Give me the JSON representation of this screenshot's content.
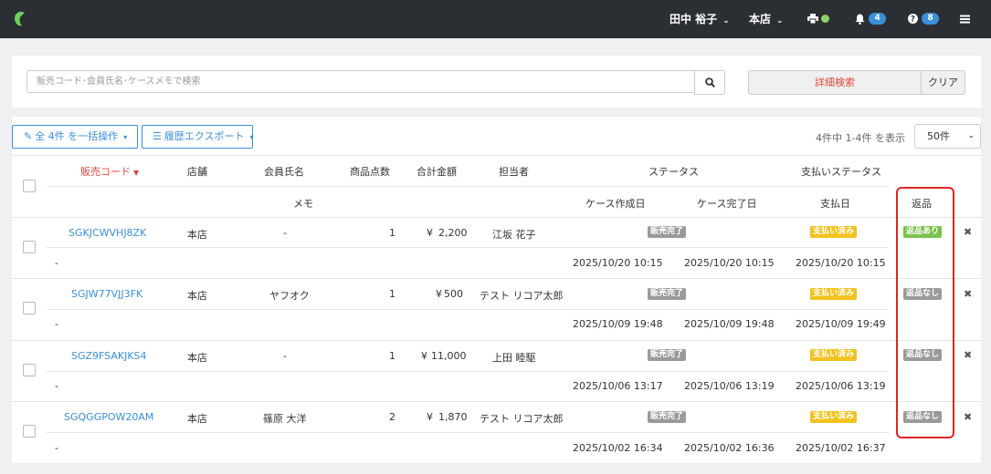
{
  "header": {
    "user_name": "田中 裕子",
    "store": "本店",
    "notifications_count": "4",
    "help_count": "8",
    "colors": {
      "bar": "#2b2f33",
      "badge": "#3a8fd9",
      "printer_status": "#8ed26b"
    }
  },
  "search": {
    "placeholder": "販売コード･会員氏名･ケースメモで検索",
    "advanced_label": "詳細検索",
    "clear_label": "クリア"
  },
  "toolbar": {
    "bulk_label": "全 4件 を一括操作",
    "export_label": "履歴エクスポート",
    "count_text": "4件中 1-4件 を表示",
    "per_page": "50件"
  },
  "columns": {
    "code": "販売コード",
    "store": "店舗",
    "member": "会員氏名",
    "items": "商品点数",
    "total": "合計金額",
    "staff": "担当者",
    "status": "ステータス",
    "pay_status": "支払いステータス",
    "memo": "メモ",
    "created": "ケース作成日",
    "completed": "ケース完了日",
    "paid": "支払日",
    "returns": "返品"
  },
  "rows": [
    {
      "code": "SGKJCWVHJ8ZK",
      "store": "本店",
      "member": "-",
      "items": "1",
      "currency": "¥",
      "amount": "2,200",
      "staff": "江坂 花子",
      "status": "販売完了",
      "pay_status": "支払い済み",
      "returns": "返品あり",
      "memo": "-",
      "created": "2025/10/20 10:15",
      "completed": "2025/10/20 10:15",
      "paid": "2025/10/20 10:15"
    },
    {
      "code": "SGJW77VJJ3FK",
      "store": "本店",
      "member": "ヤフオク",
      "items": "1",
      "currency": "¥",
      "amount": "500",
      "staff": "テスト リコア太郎",
      "status": "販売完了",
      "pay_status": "支払い済み",
      "returns": "返品なし",
      "memo": "-",
      "created": "2025/10/09 19:48",
      "completed": "2025/10/09 19:48",
      "paid": "2025/10/09 19:49"
    },
    {
      "code": "SGZ9FSAKJKS4",
      "store": "本店",
      "member": "-",
      "items": "1",
      "currency": "¥",
      "amount": "11,000",
      "staff": "上田 睦駆",
      "status": "販売完了",
      "pay_status": "支払い済み",
      "returns": "返品なし",
      "memo": "-",
      "created": "2025/10/06 13:17",
      "completed": "2025/10/06 13:19",
      "paid": "2025/10/06 13:19"
    },
    {
      "code": "SGQGGPOW20AM",
      "store": "本店",
      "member": "篠原 大洋",
      "items": "2",
      "currency": "¥",
      "amount": "1,870",
      "staff": "テスト リコア太郎",
      "status": "販売完了",
      "pay_status": "支払い済み",
      "returns": "返品なし",
      "memo": "-",
      "created": "2025/10/02 16:34",
      "completed": "2025/10/02 16:36",
      "paid": "2025/10/02 16:37"
    }
  ]
}
